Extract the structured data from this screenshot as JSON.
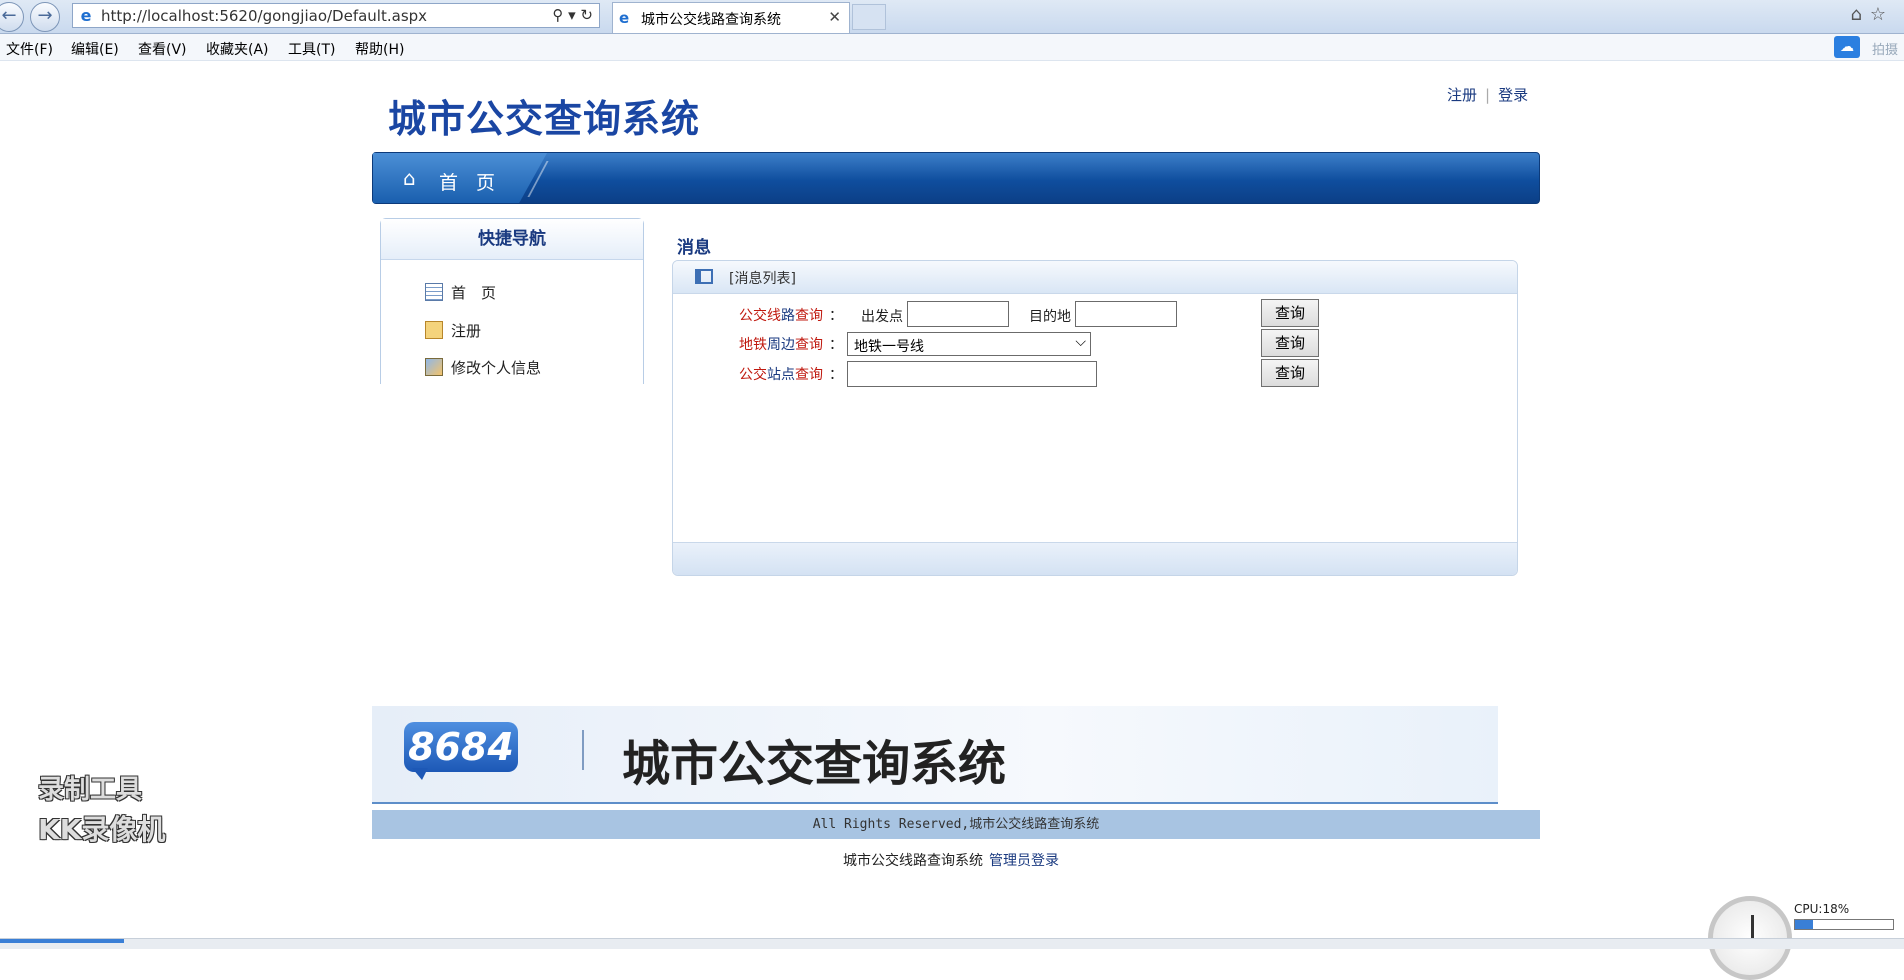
{
  "browser": {
    "url": "http://localhost:5620/gongjiao/Default.aspx",
    "tab_title": "城市公交线路查询系统",
    "menu": [
      "文件(F)",
      "编辑(E)",
      "查看(V)",
      "收藏夹(A)",
      "工具(T)",
      "帮助(H)"
    ],
    "right_text": "拍摄"
  },
  "header": {
    "site_title": "城市公交查询系统",
    "register": "注册",
    "login": "登录",
    "nav_home": "首 页"
  },
  "sidebar": {
    "title": "快捷导航",
    "items": [
      {
        "label": "首　页",
        "icon": "table-icon"
      },
      {
        "label": "注册",
        "icon": "clipboard-icon"
      },
      {
        "label": "修改个人信息",
        "icon": "edit-profile-icon"
      }
    ]
  },
  "main": {
    "section_title": "消息",
    "panel_label": "[消息列表]",
    "route_query": {
      "label_red": "公交线",
      "label_blue": "路",
      "label_red2": "查询",
      "colon": "：",
      "from_label": "出发点",
      "from_value": "",
      "to_label": "目的地",
      "to_value": "",
      "button": "查询"
    },
    "metro_query": {
      "label_red": "地铁",
      "label_blue": "周边",
      "label_red2": "查询",
      "colon": "：",
      "selected": "地铁一号线",
      "button": "查询"
    },
    "station_query": {
      "label_red": "公交",
      "label_blue": "站点",
      "label_red2": "查询",
      "colon": "：",
      "value": "",
      "button": "查询"
    }
  },
  "footer": {
    "logo_text": "8684",
    "banner_title": "城市公交查询系统",
    "copyright": "All Rights Reserved,城市公交线路查询系统",
    "bottom_text": "城市公交线路查询系统",
    "admin_login": "管理员登录"
  },
  "overlay": {
    "watermark_line1": "录制工具",
    "watermark_line2": "KK录像机",
    "cpu_label": "CPU:18%",
    "cpu_percent": 18
  }
}
